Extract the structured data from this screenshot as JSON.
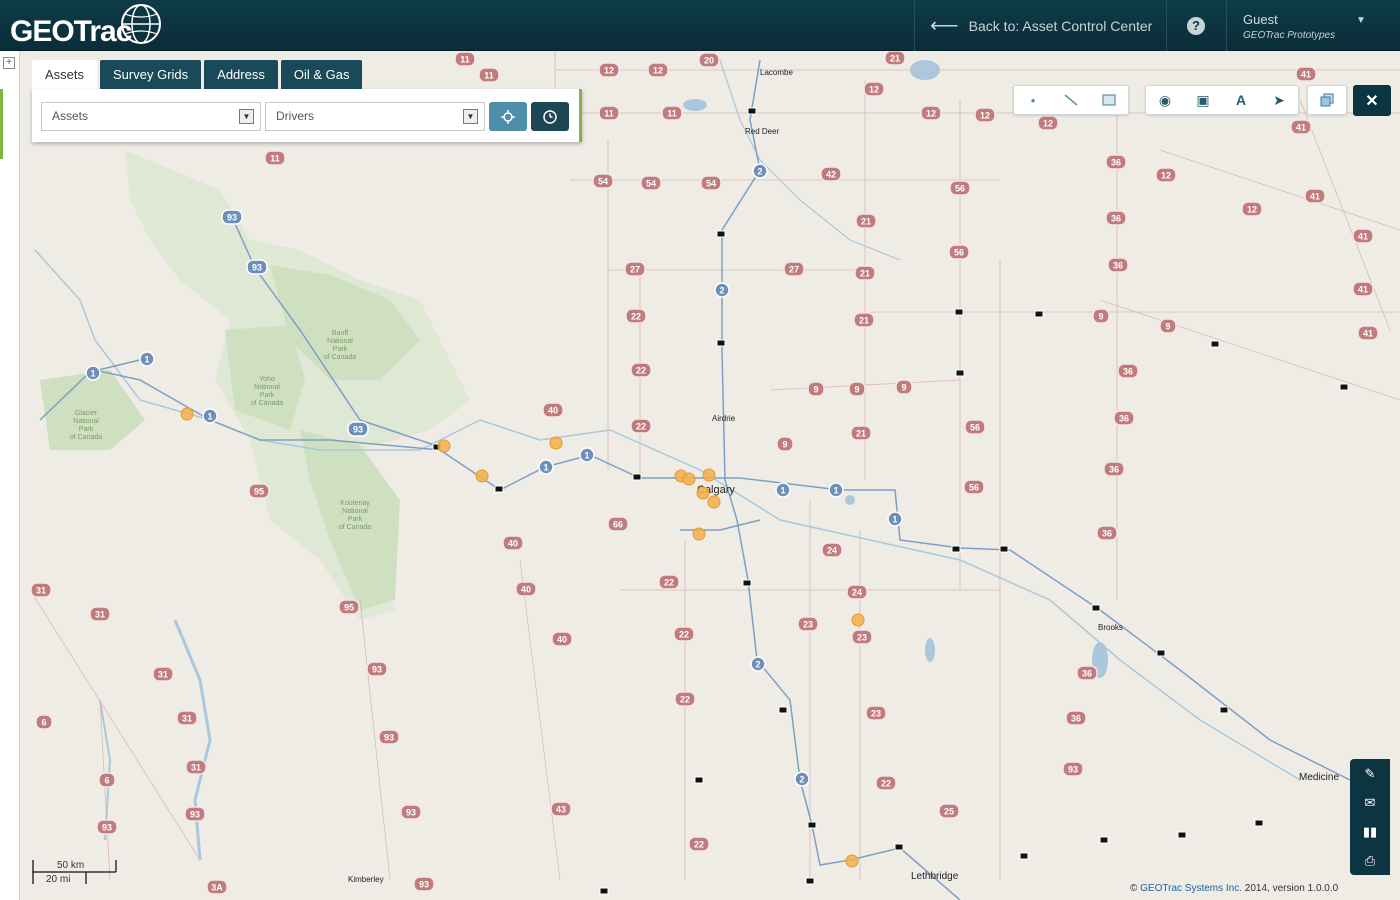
{
  "header": {
    "logo_text": "GEOTrac",
    "back_label": "Back to: Asset Control Center",
    "help_label": "?",
    "user_name": "Guest",
    "user_org": "GEOTrac Prototypes"
  },
  "panel": {
    "tabs": [
      {
        "label": "Assets",
        "active": true
      },
      {
        "label": "Survey Grids",
        "active": false
      },
      {
        "label": "Address",
        "active": false
      },
      {
        "label": "Oil & Gas",
        "active": false
      }
    ],
    "asset_select": "Assets",
    "driver_select": "Drivers",
    "locate_icon": "crosshair-icon",
    "history_icon": "clock-icon"
  },
  "toolbar": {
    "draw_tools": [
      "point-icon",
      "line-icon",
      "rectangle-icon"
    ],
    "map_tools": [
      "globe-icon",
      "layer-photo-icon",
      "road-icon",
      "navigate-icon"
    ],
    "layers_icon": "layers-icon",
    "close_icon": "close-icon"
  },
  "side_tools": [
    "paperclip-icon",
    "envelope-icon",
    "bar-chart-icon",
    "print-icon"
  ],
  "map": {
    "cities": [
      "Lacombe",
      "Red Deer",
      "Airdrie",
      "Calgary",
      "Brooks",
      "Medicine",
      "Lethbridge",
      "Kimberley"
    ],
    "parks": [
      "Banff National Park of Canada",
      "Yoho National Park of Canada",
      "Glacier National Park of Canada",
      "Kootenay National Park of Canada"
    ],
    "highway_shields": [
      "11",
      "11",
      "12",
      "12",
      "20",
      "21",
      "41",
      "12",
      "11",
      "11",
      "11",
      "12",
      "12",
      "41",
      "12",
      "54",
      "54",
      "54",
      "42",
      "36",
      "56",
      "12",
      "41",
      "12",
      "21",
      "36",
      "27",
      "27",
      "21",
      "56",
      "36",
      "41",
      "22",
      "21",
      "9",
      "9",
      "41",
      "41",
      "22",
      "9",
      "9",
      "9",
      "36",
      "40",
      "22",
      "21",
      "56",
      "36",
      "9",
      "36",
      "95",
      "56",
      "66",
      "22",
      "24",
      "36",
      "40",
      "22",
      "24",
      "40",
      "95",
      "23",
      "40",
      "22",
      "23",
      "93",
      "31",
      "31",
      "31",
      "31",
      "31",
      "22",
      "23",
      "93",
      "36",
      "6",
      "6",
      "36",
      "43",
      "22",
      "25",
      "93",
      "3A",
      "93",
      "93",
      "93",
      "93"
    ],
    "route_markers": [
      "1",
      "1",
      "1",
      "1",
      "1",
      "1",
      "1",
      "1",
      "2",
      "2",
      "2",
      "2",
      "93",
      "93",
      "93"
    ]
  },
  "scale": {
    "km": "50 km",
    "mi": "20 mi"
  },
  "copyright": {
    "prefix": "© ",
    "company": "GEOTrac Systems Inc.",
    "suffix": " 2014, version 1.0.0.0"
  }
}
